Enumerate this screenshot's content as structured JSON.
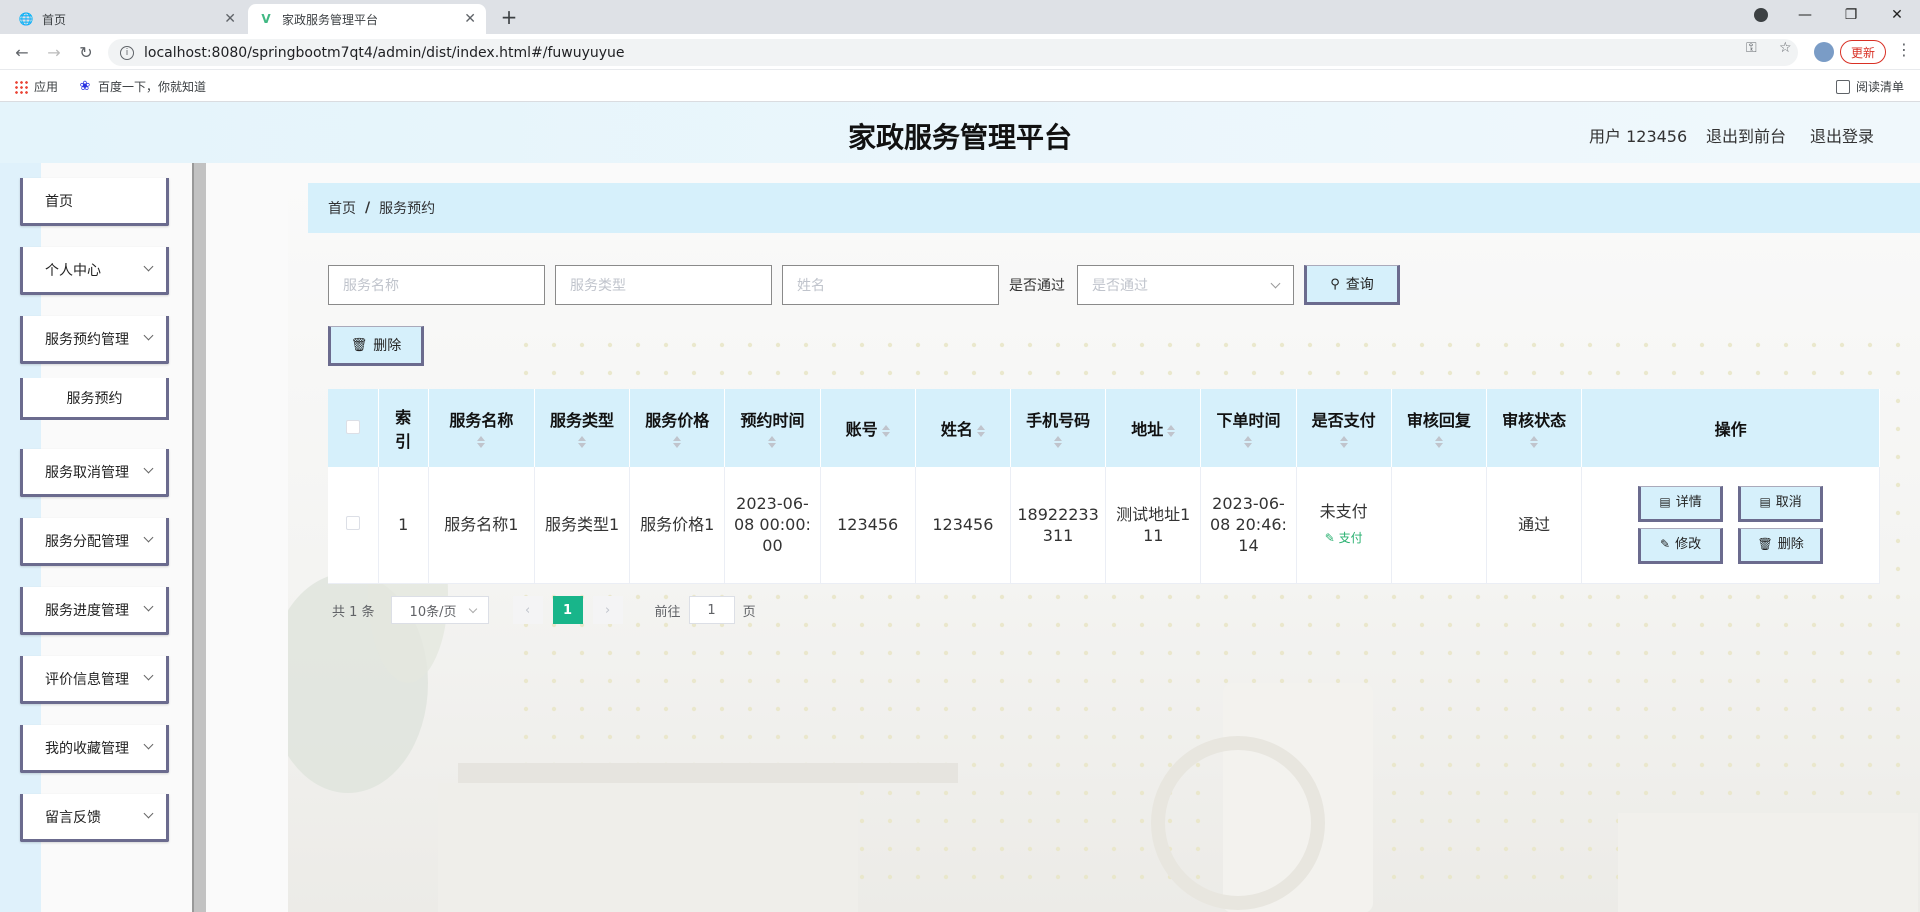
{
  "browser": {
    "tabs": [
      {
        "title": "首页",
        "active": false
      },
      {
        "title": "家政服务管理平台",
        "active": true
      }
    ],
    "url": "localhost:8080/springbootm7qt4/admin/dist/index.html#/fuwuyuyue",
    "update_label": "更新",
    "bookmarks": [
      {
        "label": "应用",
        "icon": "apps-grid-icon"
      },
      {
        "label": "百度一下，你就知道",
        "icon": "baidu-icon"
      }
    ],
    "reading_list": "阅读清单"
  },
  "header": {
    "title": "家政服务管理平台",
    "user": "用户 123456",
    "to_front": "退出到前台",
    "logout": "退出登录"
  },
  "sidebar": {
    "items": [
      {
        "label": "首页",
        "expandable": false
      },
      {
        "label": "个人中心",
        "expandable": true
      },
      {
        "label": "服务预约管理",
        "expandable": true
      },
      {
        "label": "服务预约",
        "sub": true
      },
      {
        "label": "服务取消管理",
        "expandable": true
      },
      {
        "label": "服务分配管理",
        "expandable": true
      },
      {
        "label": "服务进度管理",
        "expandable": true
      },
      {
        "label": "评价信息管理",
        "expandable": true
      },
      {
        "label": "我的收藏管理",
        "expandable": true
      },
      {
        "label": "留言反馈",
        "expandable": true
      }
    ]
  },
  "breadcrumb": {
    "home": "首页",
    "sep": "/",
    "current": "服务预约"
  },
  "search": {
    "name_placeholder": "服务名称",
    "type_placeholder": "服务类型",
    "person_placeholder": "姓名",
    "pass_label": "是否通过",
    "pass_placeholder": "是否通过",
    "query_label": "查询"
  },
  "actions": {
    "delete_label": "删除"
  },
  "table": {
    "columns": [
      "",
      "索引",
      "服务名称",
      "服务类型",
      "服务价格",
      "预约时间",
      "账号",
      "姓名",
      "手机号码",
      "地址",
      "下单时间",
      "是否支付",
      "审核回复",
      "审核状态",
      "操作"
    ],
    "rows": [
      {
        "index": "1",
        "service_name": "服务名称1",
        "service_type": "服务类型1",
        "service_price": "服务价格1",
        "appointment_time": "2023-06-08 00:00:00",
        "account": "123456",
        "name": "123456",
        "phone": "18922233311",
        "address": "测试地址111",
        "order_time": "2023-06-08 20:46:14",
        "paid": "未支付",
        "pay_label": "支付",
        "review_reply": "",
        "review_status": "通过",
        "ops": {
          "detail": "详情",
          "cancel": "取消",
          "edit": "修改",
          "delete": "删除"
        }
      }
    ]
  },
  "pagination": {
    "total": "共 1 条",
    "page_size": "10条/页",
    "prev": "‹",
    "current": "1",
    "next": "›",
    "goto_label": "前往",
    "goto_value": "1",
    "page_unit": "页"
  },
  "colors": {
    "accent": "#d6f0fb",
    "border": "#6b6b8e",
    "page_active": "#18b58a",
    "pay": "#27b06f"
  }
}
